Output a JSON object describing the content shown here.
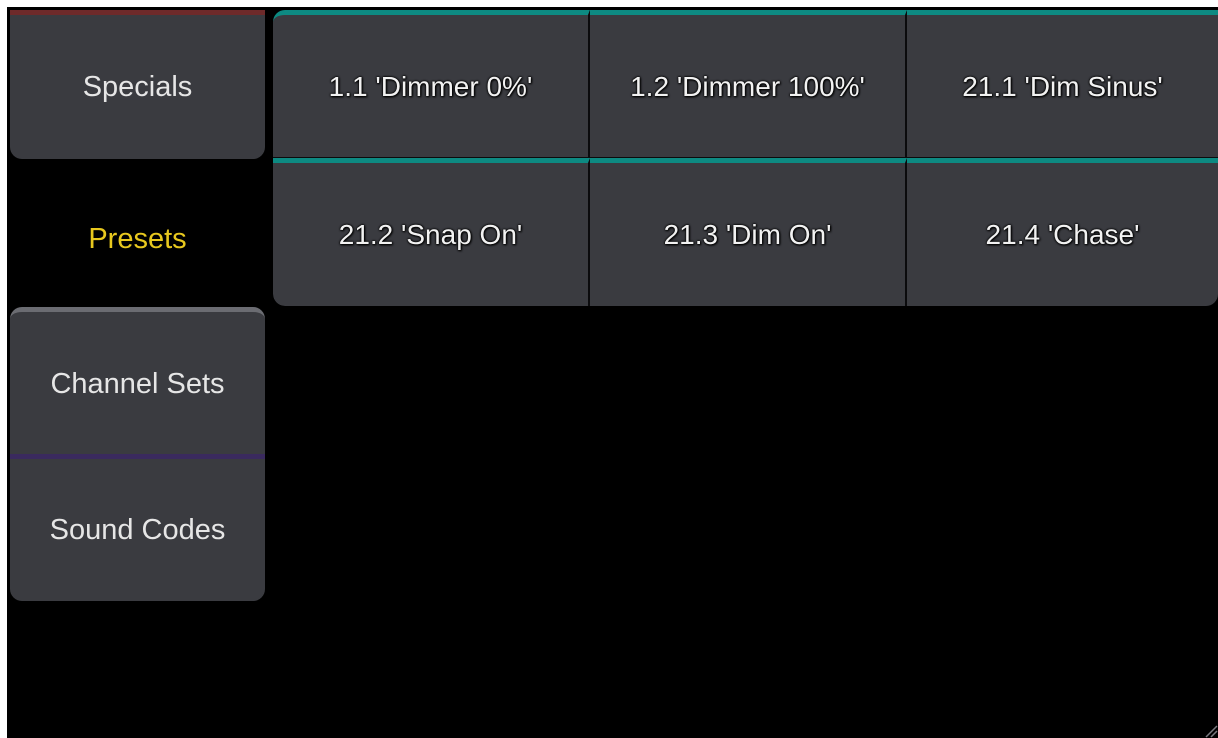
{
  "categories": {
    "specials_label": "Specials",
    "presets_label": "Presets",
    "channel_sets_label": "Channel Sets",
    "sound_codes_label": "Sound Codes",
    "selected": "Presets"
  },
  "presets": [
    {
      "label": "1.1 'Dimmer 0%'"
    },
    {
      "label": "1.2 'Dimmer 100%'"
    },
    {
      "label": "21.1 'Dim Sinus'"
    },
    {
      "label": "21.2 'Snap On'"
    },
    {
      "label": "21.3 'Dim On'"
    },
    {
      "label": "21.4 'Chase'"
    }
  ],
  "colors": {
    "background": "#000000",
    "card": "#3a3b40",
    "preset_accent": "#0d8a82",
    "selected_text": "#e8c81e",
    "specials_accent": "#6e2a2a",
    "sound_codes_accent": "#3a2a5e"
  },
  "icons": {
    "resize_grip": "resize-grip-icon"
  }
}
